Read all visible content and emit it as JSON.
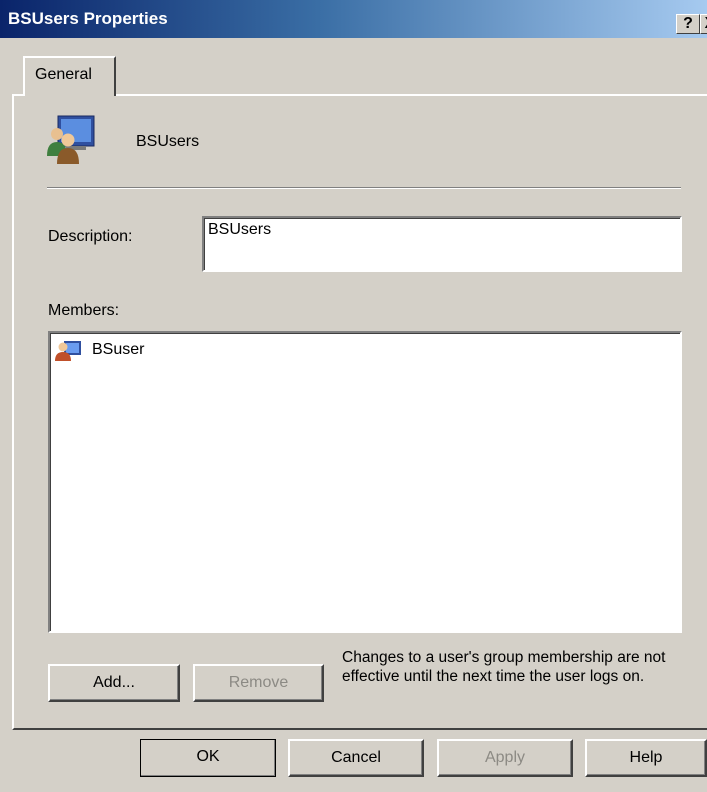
{
  "window": {
    "title": "BSUsers Properties",
    "help_glyph": "?",
    "close_glyph": "X"
  },
  "tabs": [
    {
      "label": "General",
      "selected": true
    }
  ],
  "group": {
    "icon": "users-group-icon",
    "name": "BSUsers"
  },
  "description": {
    "label": "Description:",
    "value": "BSUsers"
  },
  "members": {
    "label": "Members:",
    "items": [
      {
        "name": "BSuser",
        "icon": "user-icon"
      }
    ]
  },
  "member_buttons": {
    "add_label": "Add...",
    "remove_label": "Remove",
    "remove_disabled": true
  },
  "note": "Changes to a user's group membership are not effective until the next time the user logs on.",
  "footer": {
    "ok_label": "OK",
    "cancel_label": "Cancel",
    "apply_label": "Apply",
    "apply_disabled": true,
    "help_label": "Help"
  },
  "colors": {
    "dialog_bg": "#d4d0c8",
    "titlebar_start": "#0a246a",
    "titlebar_end": "#a6caf0",
    "disabled_text": "#8c8a84"
  }
}
